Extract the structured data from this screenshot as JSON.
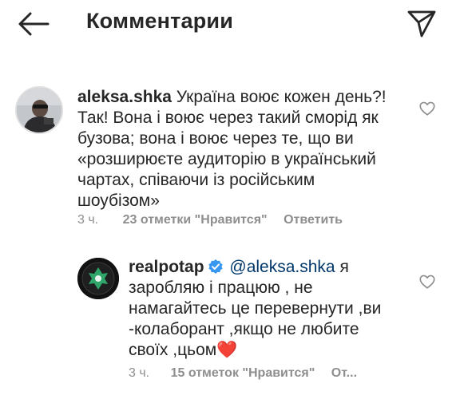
{
  "header": {
    "title": "Комментарии"
  },
  "comments": [
    {
      "username": "aleksa.shka",
      "text_first": "Україна воює кожен день?!",
      "text_rest": "Так! Вона і воює через такий сморід як бузова; вона і воює через те, що ви «розширюєте аудиторію в український чартах, співаючи із російським шоубізом»",
      "time": "3 ч.",
      "likes": "23 отметки \"Нравится\"",
      "reply": "Ответить"
    },
    {
      "username": "realpotap",
      "mention": "@aleksa.shka",
      "text": "я заробляю і працюю , не намагайтесь це перевернути ,ви -колаборант ,якщо не любите своїх ,цьом",
      "emoji": "❤️",
      "time": "3 ч.",
      "likes": "15 отметок \"Нравится\"",
      "reply": "От..."
    }
  ]
}
